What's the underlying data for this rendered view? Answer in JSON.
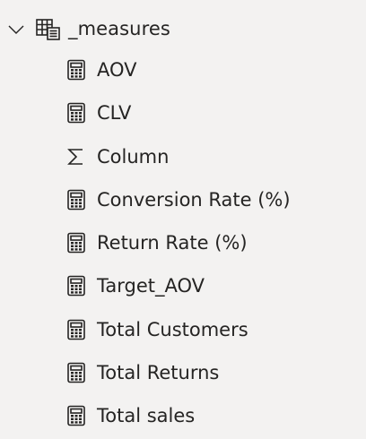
{
  "table": {
    "name": "_measures",
    "expanded": true
  },
  "fields": [
    {
      "label": "AOV",
      "icon": "calculator-icon"
    },
    {
      "label": "CLV",
      "icon": "calculator-icon"
    },
    {
      "label": "Column",
      "icon": "sigma-icon"
    },
    {
      "label": "Conversion Rate (%)",
      "icon": "calculator-icon"
    },
    {
      "label": "Return Rate (%)",
      "icon": "calculator-icon"
    },
    {
      "label": "Target_AOV",
      "icon": "calculator-icon"
    },
    {
      "label": "Total Customers",
      "icon": "calculator-icon"
    },
    {
      "label": "Total Returns",
      "icon": "calculator-icon"
    },
    {
      "label": "Total sales",
      "icon": "calculator-icon"
    }
  ],
  "colors": {
    "background": "#f3f2f1",
    "text": "#252423",
    "icon": "#252423"
  }
}
